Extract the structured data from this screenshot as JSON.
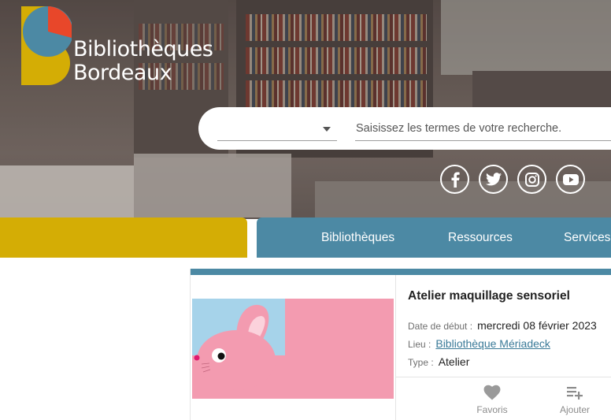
{
  "branding": {
    "logo_line1": "Bibliothèques",
    "logo_line2": "Bordeaux",
    "colors": {
      "yellow": "#d4ad05",
      "blue": "#4c89a4",
      "orange": "#e8472a"
    }
  },
  "search": {
    "scope_value": "",
    "placeholder": "Saisissez les termes de votre recherche."
  },
  "social": [
    {
      "name": "facebook-icon"
    },
    {
      "name": "twitter-icon"
    },
    {
      "name": "instagram-icon"
    },
    {
      "name": "youtube-icon"
    }
  ],
  "nav": {
    "items": [
      {
        "label": "Bibliothèques"
      },
      {
        "label": "Ressources"
      },
      {
        "label": "Services"
      }
    ]
  },
  "event": {
    "title": "Atelier maquillage sensoriel",
    "start_label": "Date de début :",
    "start_value": "mercredi 08 février 2023",
    "place_label": "Lieu :",
    "place_value": "Bibliothèque Mériadeck",
    "type_label": "Type :",
    "type_value": "Atelier",
    "favorite_label": "Favoris",
    "add_label": "Ajouter"
  }
}
